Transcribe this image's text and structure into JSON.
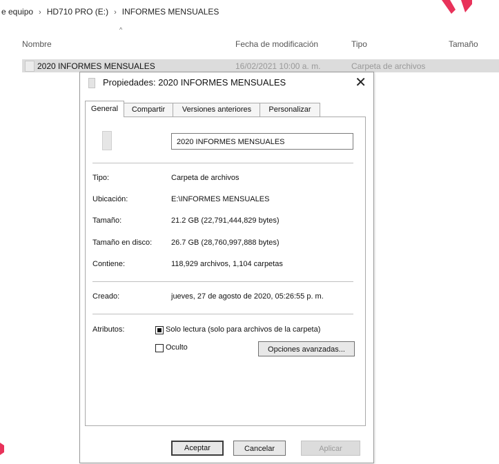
{
  "breadcrumb": {
    "items": [
      "e equipo",
      "HD710 PRO (E:)",
      "INFORMES MENSUALES"
    ],
    "separator": "›"
  },
  "columns": {
    "name": "Nombre",
    "modified": "Fecha de modificación",
    "type": "Tipo",
    "size": "Tamaño",
    "sort_indicator": "^"
  },
  "file_row": {
    "name": "2020 INFORMES MENSUALES",
    "modified": "16/02/2021 10:00 a. m.",
    "type": "Carpeta de archivos"
  },
  "dialog": {
    "title": "Propiedades: 2020 INFORMES MENSUALES",
    "close_glyph": "✕",
    "tabs": [
      "General",
      "Compartir",
      "Versiones anteriores",
      "Personalizar"
    ],
    "active_tab": "General",
    "folder_name": "2020 INFORMES MENSUALES",
    "props": [
      {
        "label": "Tipo:",
        "value": "Carpeta de archivos"
      },
      {
        "label": "Ubicación:",
        "value": "E:\\INFORMES MENSUALES"
      },
      {
        "label": "Tamaño:",
        "value": "21.2 GB (22,791,444,829 bytes)"
      },
      {
        "label": "Tamaño en disco:",
        "value": "26.7 GB (28,760,997,888 bytes)"
      },
      {
        "label": "Contiene:",
        "value": "118,929 archivos, 1,104 carpetas"
      }
    ],
    "created": {
      "label": "Creado:",
      "value": "jueves, 27 de agosto de 2020, 05:26:55 p. m."
    },
    "attributes": {
      "label": "Atributos:",
      "readonly": {
        "label": "Solo lectura (solo para archivos de la carpeta)",
        "checked": true
      },
      "hidden": {
        "label": "Oculto",
        "checked": false
      },
      "advanced_button": "Opciones avanzadas..."
    },
    "buttons": {
      "ok": "Aceptar",
      "cancel": "Cancelar",
      "apply": "Aplicar"
    }
  },
  "colors": {
    "selection": "#dcdcdc",
    "accent_red": "#e8325a"
  }
}
